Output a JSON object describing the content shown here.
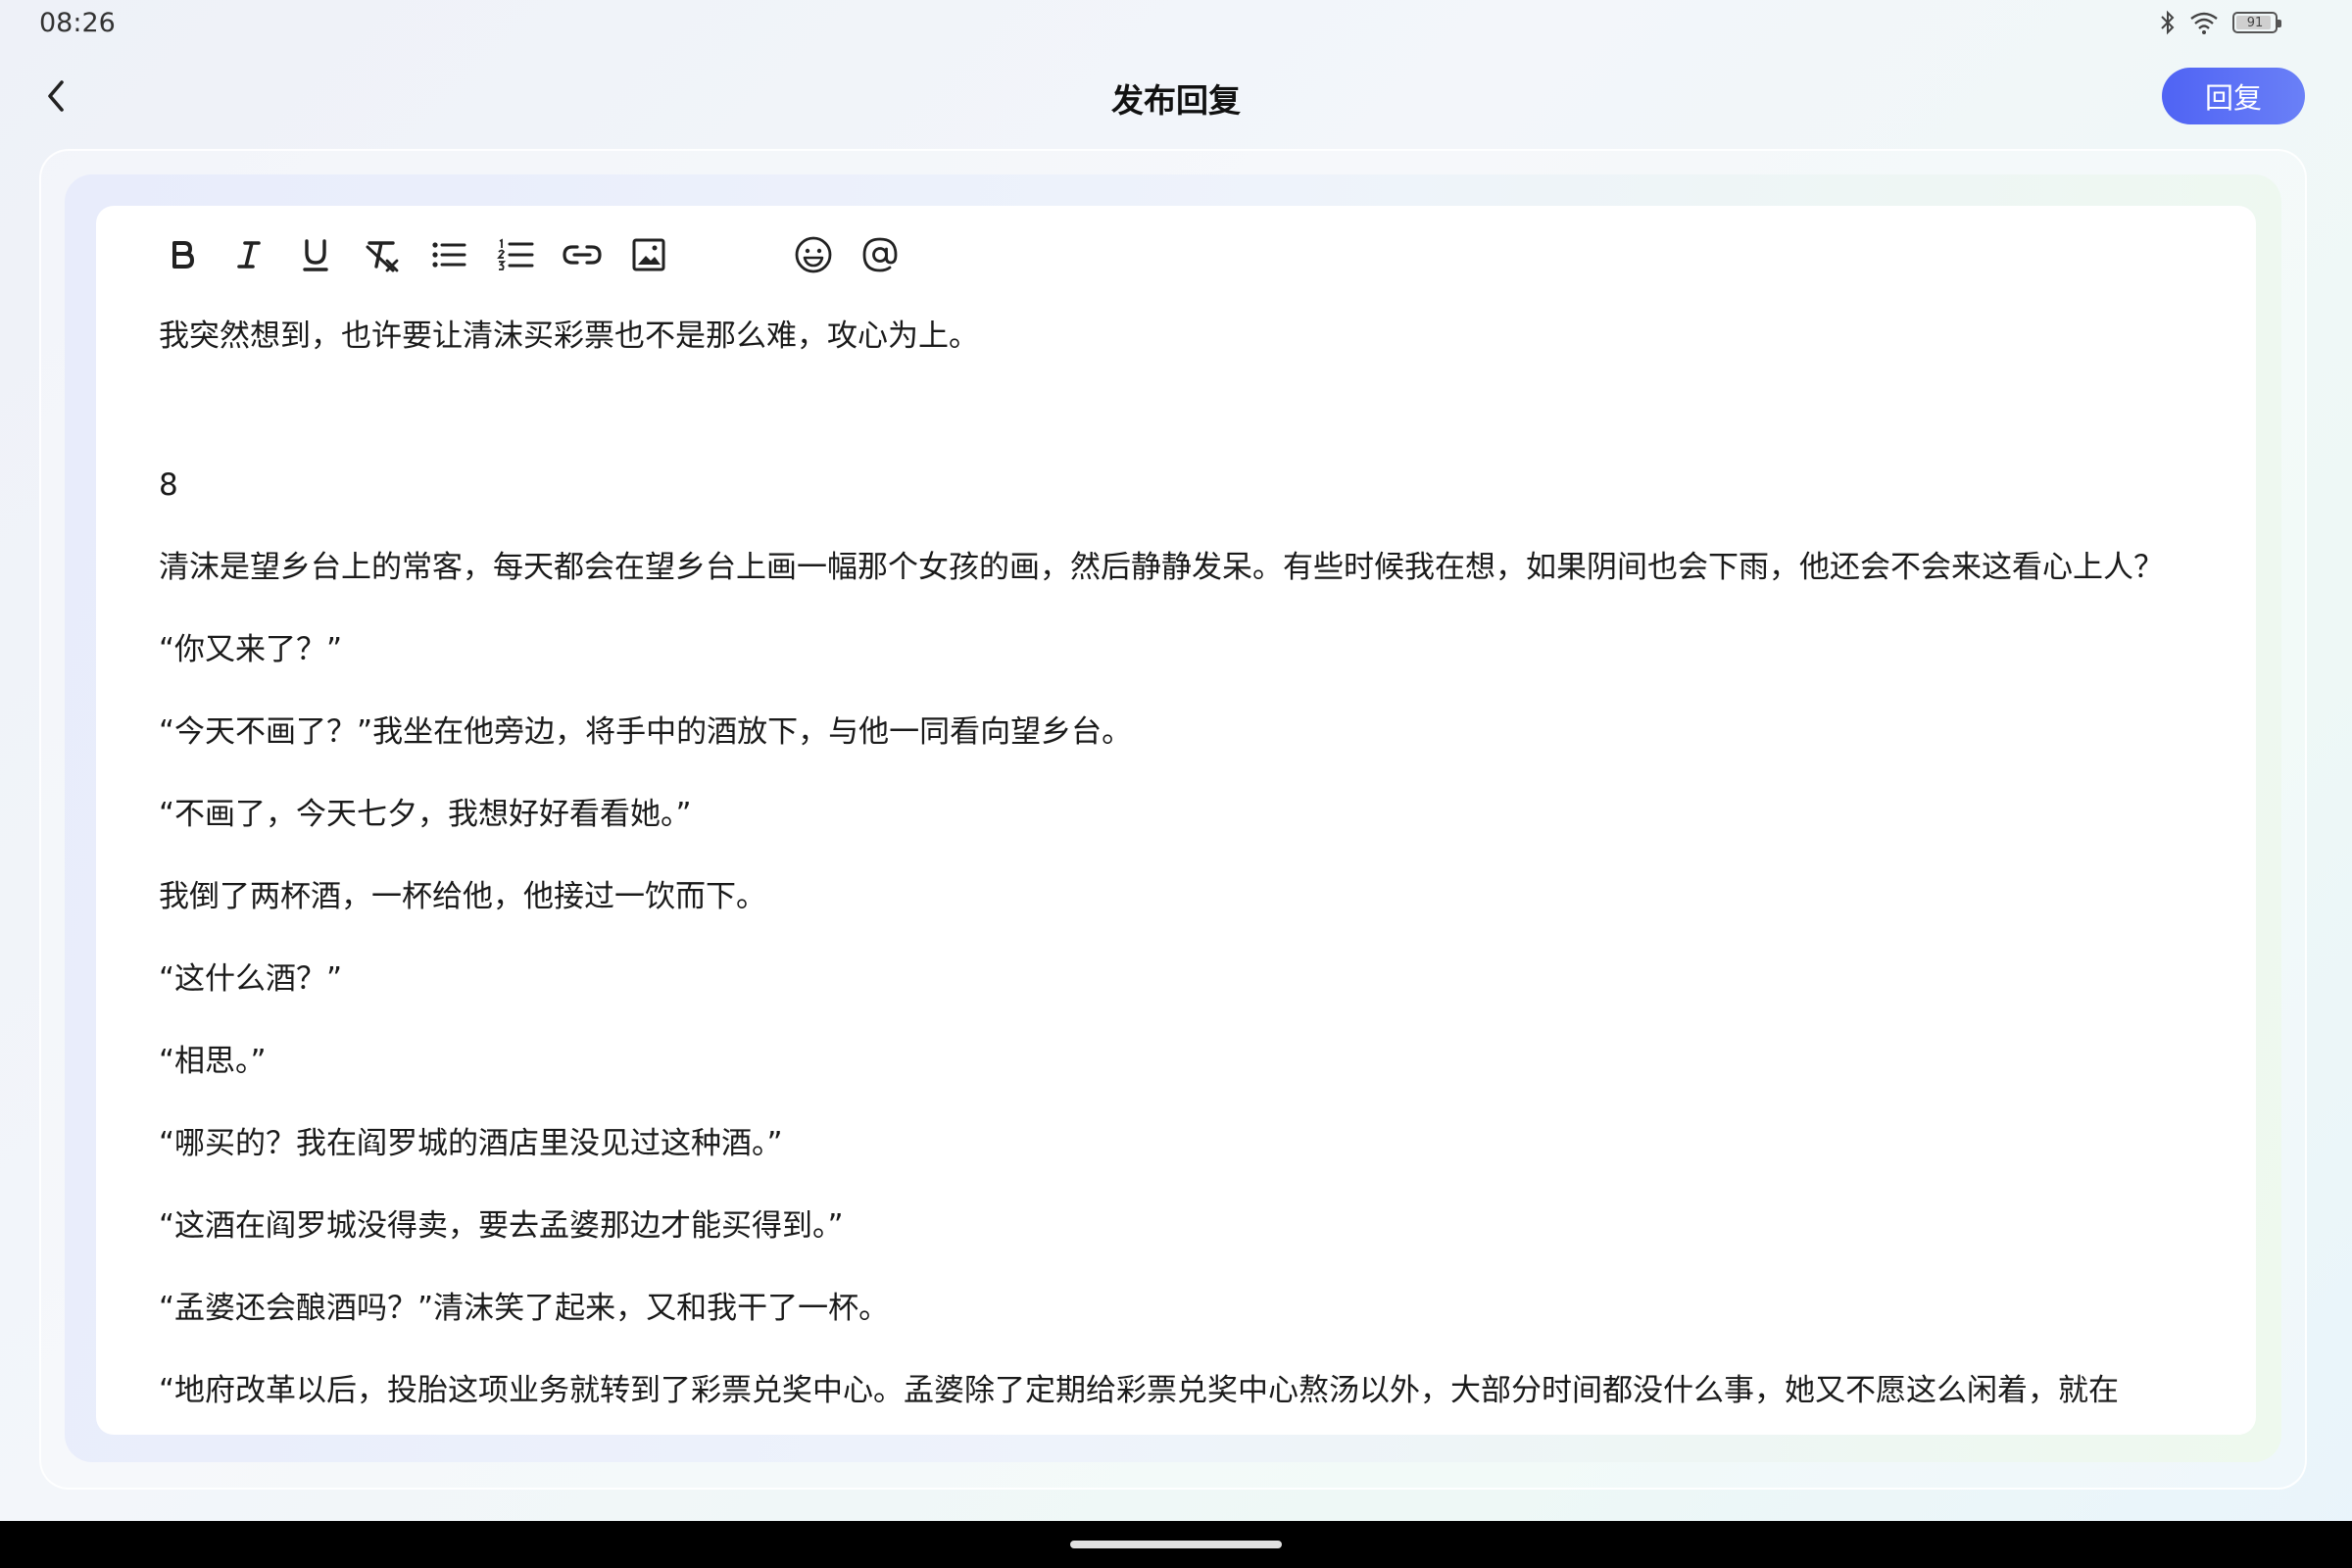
{
  "status_bar": {
    "time": "08:26",
    "battery_level": "91",
    "icons": [
      "bluetooth-icon",
      "wifi-icon",
      "battery-icon"
    ]
  },
  "header": {
    "title": "发布回复",
    "reply_label": "回复"
  },
  "toolbar": {
    "tools": [
      "bold-icon",
      "italic-icon",
      "underline-icon",
      "clear-format-icon",
      "bullet-list-icon",
      "numbered-list-icon",
      "link-icon",
      "image-icon",
      "emoji-icon",
      "mention-icon"
    ]
  },
  "colors": {
    "accent": "#5a6ff5",
    "text": "#1a1a1a"
  },
  "content": {
    "paragraphs": [
      "我突然想到，也许要让清沫买彩票也不是那么难，攻心为上。",
      "",
      "8",
      "清沫是望乡台上的常客，每天都会在望乡台上画一幅那个女孩的画，然后静静发呆。有些时候我在想，如果阴间也会下雨，他还会不会来这看心上人？",
      "“你又来了？”",
      "“今天不画了？”我坐在他旁边，将手中的酒放下，与他一同看向望乡台。",
      "“不画了，今天七夕，我想好好看看她。”",
      "我倒了两杯酒，一杯给他，他接过一饮而下。",
      "“这什么酒？”",
      "“相思。”",
      "“哪买的？我在阎罗城的酒店里没见过这种酒。”",
      "“这酒在阎罗城没得卖，要去孟婆那边才能买得到。”",
      "“孟婆还会酿酒吗？”清沫笑了起来，又和我干了一杯。",
      "“地府改革以后，投胎这项业务就转到了彩票兑奖中心。孟婆除了定期给彩票兑奖中心熬汤以外，大部分时间都没什么事，她又不愿这么闲着，就在"
    ]
  }
}
